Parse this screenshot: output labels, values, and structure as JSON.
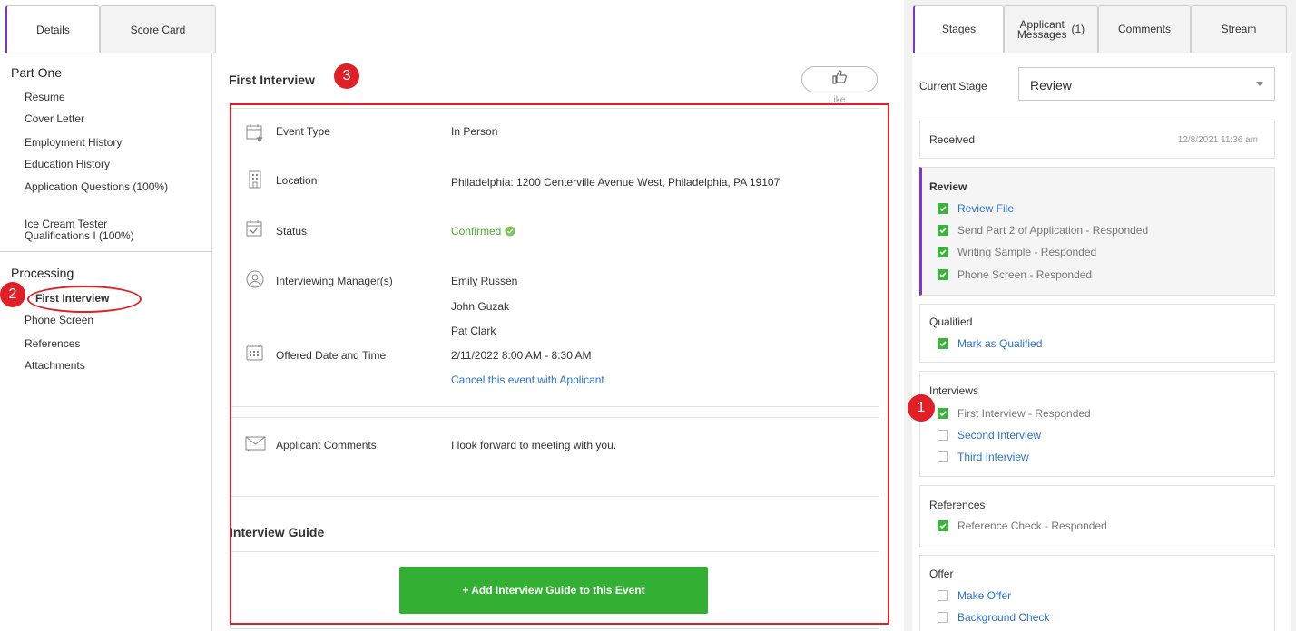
{
  "left_tabs": {
    "details": "Details",
    "score_card": "Score Card"
  },
  "nav": {
    "part_one": "Part One",
    "part_one_items": [
      "Resume",
      "Cover Letter",
      "Employment History",
      "Education History",
      "Application Questions (100%)",
      "Ice Cream Tester Qualifications I (100%)"
    ],
    "processing": "Processing",
    "processing_items": [
      "First Interview",
      "Phone Screen",
      "References",
      "Attachments"
    ]
  },
  "main": {
    "title": "First Interview",
    "like": "Like",
    "rows": {
      "event_type_label": "Event Type",
      "event_type_value": "In Person",
      "location_label": "Location",
      "location_value": "Philadelphia: 1200 Centerville Avenue West, Philadelphia, PA 19107",
      "status_label": "Status",
      "status_value": "Confirmed",
      "managers_label": "Interviewing Manager(s)",
      "managers": [
        "Emily Russen",
        "John Guzak",
        "Pat Clark"
      ],
      "offered_label": "Offered Date and Time",
      "offered_value": "2/11/2022 8:00 AM - 8:30 AM",
      "cancel_link": "Cancel this event with Applicant"
    },
    "comments_label": "Applicant Comments",
    "comments_value": "I look forward to meeting with you.",
    "guide_title": "Interview Guide",
    "guide_button": "+ Add Interview Guide to this Event"
  },
  "badges": {
    "one": "1",
    "two": "2",
    "three": "3"
  },
  "right_tabs": {
    "stages": "Stages",
    "messages_line1": "Applicant",
    "messages_line2": "Messages",
    "messages_count": "(1)",
    "comments": "Comments",
    "stream": "Stream"
  },
  "stages": {
    "current_stage_label": "Current Stage",
    "current_stage_value": "Review",
    "received": "Received",
    "received_date": "12/8/2021 11:36 am",
    "review": "Review",
    "review_tasks": [
      {
        "name": "Review File",
        "suffix": ""
      },
      {
        "name": "Send Part 2 of Application",
        "suffix": " - Responded"
      },
      {
        "name": "Writing Sample",
        "suffix": " - Responded"
      },
      {
        "name": "Phone Screen",
        "suffix": " - Responded"
      }
    ],
    "qualified": "Qualified",
    "qualified_task": "Mark as Qualified",
    "interviews": "Interviews",
    "interview_tasks": [
      {
        "name": "First Interview",
        "suffix": " - Responded"
      },
      {
        "name": "Second Interview",
        "suffix": ""
      },
      {
        "name": "Third Interview",
        "suffix": ""
      }
    ],
    "references": "References",
    "reference_task": {
      "name": "Reference Check",
      "suffix": " - Responded"
    },
    "offer": "Offer",
    "offer_tasks": [
      "Make Offer",
      "Background Check"
    ]
  },
  "colors": {
    "accent": "#7b35c8",
    "annotation_red": "#e01f26",
    "success_green": "#33b033",
    "link_blue": "#2a72c9"
  }
}
